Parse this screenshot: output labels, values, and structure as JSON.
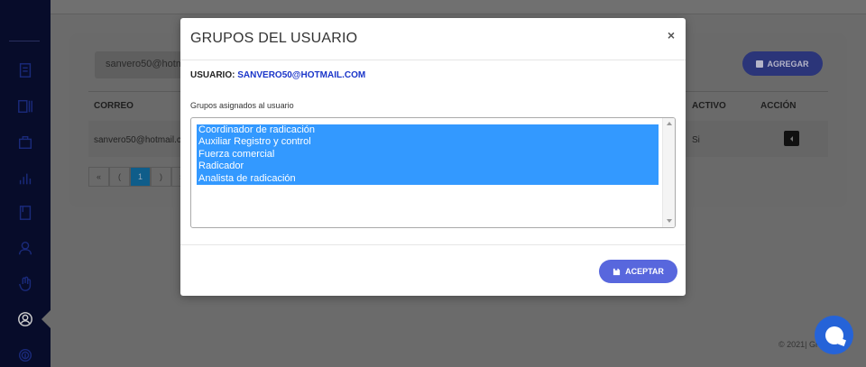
{
  "background": {
    "search_value": "sanvero50@hotm",
    "add_button_label": "AGREGAR",
    "columns": [
      "CORREO",
      "ACTIVO",
      "ACCIÓN"
    ],
    "row": {
      "email": "sanvero50@hotmail.c",
      "active": "Si"
    },
    "pagination": [
      "«",
      "(",
      "1",
      ")",
      "»"
    ],
    "footer_text": "© 2021| Gr"
  },
  "modal": {
    "title": "GRUPOS DEL USUARIO",
    "close_label": "×",
    "user_label": "USUARIO:",
    "user_value": "SANVERO50@HOTMAIL.COM",
    "groups_label": "Grupos asignados al usuario",
    "groups": [
      "Coordinador de radicación",
      "Auxiliar Registro y control",
      "Fuerza comercial",
      "Radicador",
      "Analista de radicación"
    ],
    "accept_label": "ACEPTAR"
  },
  "colors": {
    "sidebar": "#070c2a",
    "accent": "#5867dd",
    "selection": "#3399ff",
    "user_value": "#1a35c9",
    "chat": "#2563d8"
  },
  "icons": [
    "list-icon",
    "columns-icon",
    "briefcase-icon",
    "bar-chart-icon",
    "book-icon",
    "user-icon",
    "hand-icon",
    "user-circle-icon",
    "fingerprint-icon",
    "save-icon",
    "plus-icon",
    "chat-icon"
  ]
}
